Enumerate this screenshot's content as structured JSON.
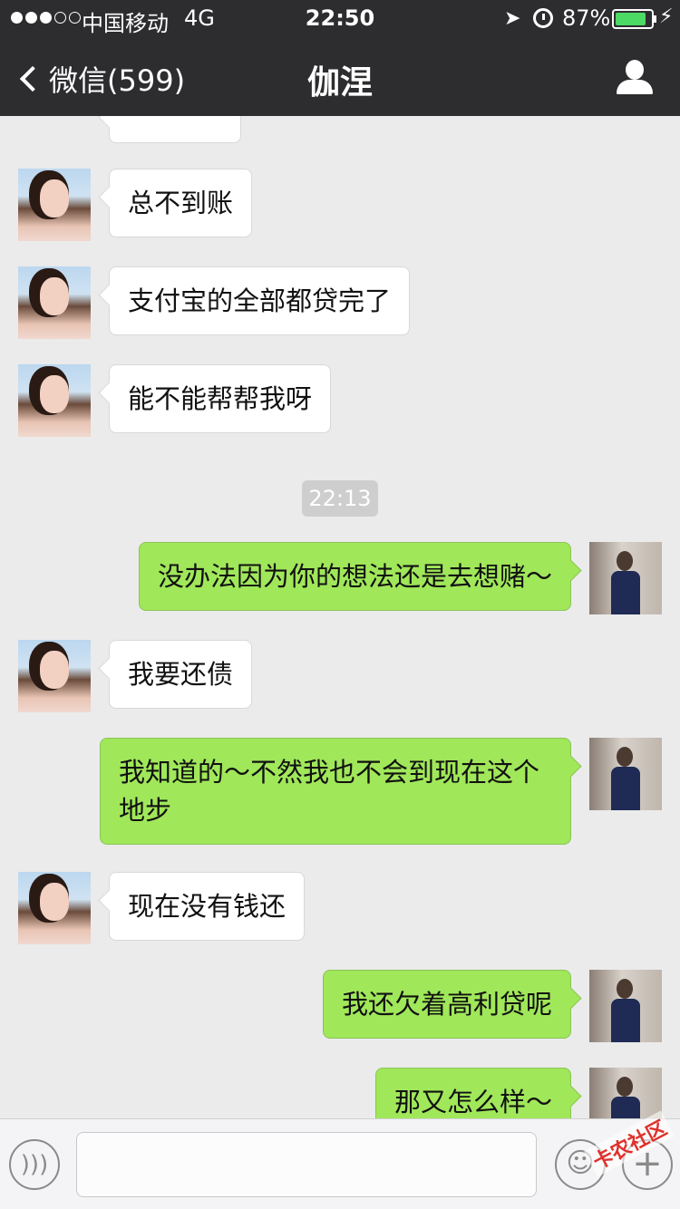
{
  "status_bar": {
    "carrier": "中国移动",
    "network": "4G",
    "time": "22:50",
    "battery_percent": "87%",
    "battery_level": 0.87,
    "signal_bars": 3,
    "signal_total": 5
  },
  "nav": {
    "back_label": "微信(599)",
    "title": "伽涅"
  },
  "messages": [
    {
      "side": "in",
      "text": "总不到账"
    },
    {
      "side": "in",
      "text": "支付宝的全部都贷完了"
    },
    {
      "side": "in",
      "text": "能不能帮帮我呀"
    },
    {
      "type": "time",
      "text": "22:13"
    },
    {
      "side": "out",
      "text": "没办法因为你的想法还是去想赌～"
    },
    {
      "side": "in",
      "text": "我要还债"
    },
    {
      "side": "out",
      "text": "我知道的～不然我也不会到现在这个地步"
    },
    {
      "side": "in",
      "text": "现在没有钱还"
    },
    {
      "side": "out",
      "text": "我还欠着高利贷呢"
    },
    {
      "side": "out",
      "text": "那又怎么样～"
    }
  ],
  "input_bar": {
    "placeholder": "",
    "voice_icon": "voice-icon",
    "emoji_icon": "emoji-icon",
    "plus_icon": "plus-icon"
  },
  "watermark": "卡农社区",
  "colors": {
    "nav_bg": "#2d2d30",
    "chat_bg": "#ebebeb",
    "outgoing_bubble": "#a0e75a",
    "incoming_bubble": "#ffffff"
  }
}
